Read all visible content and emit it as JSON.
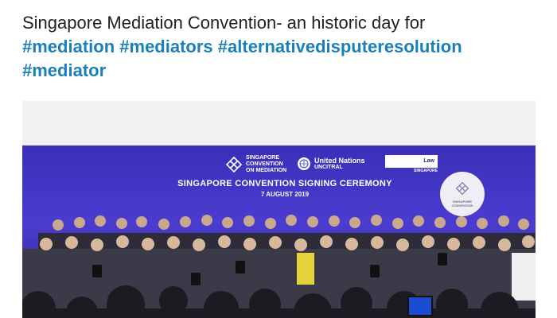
{
  "post": {
    "text": "Singapore Mediation Convention- an historic day for",
    "hashtags": [
      "#mediation",
      "#mediators",
      "#alternativedisputeresolution",
      "#mediator"
    ]
  },
  "photo": {
    "logos": {
      "singapore_convention": [
        "SINGAPORE",
        "CONVENTION",
        "ON MEDIATION"
      ],
      "un": [
        "United Nations",
        "UNCITRAL"
      ],
      "law": [
        "Law",
        "SINGAPORE"
      ]
    },
    "title": "SINGAPORE CONVENTION SIGNING CEREMONY",
    "date": "7 AUGUST 2019",
    "round_sign": [
      "SINGAPORE",
      "CONVENTION"
    ]
  },
  "colors": {
    "hashtag": "#1b7fb8",
    "backdrop": "#4b3cd0",
    "text": "#1f1f1f"
  }
}
